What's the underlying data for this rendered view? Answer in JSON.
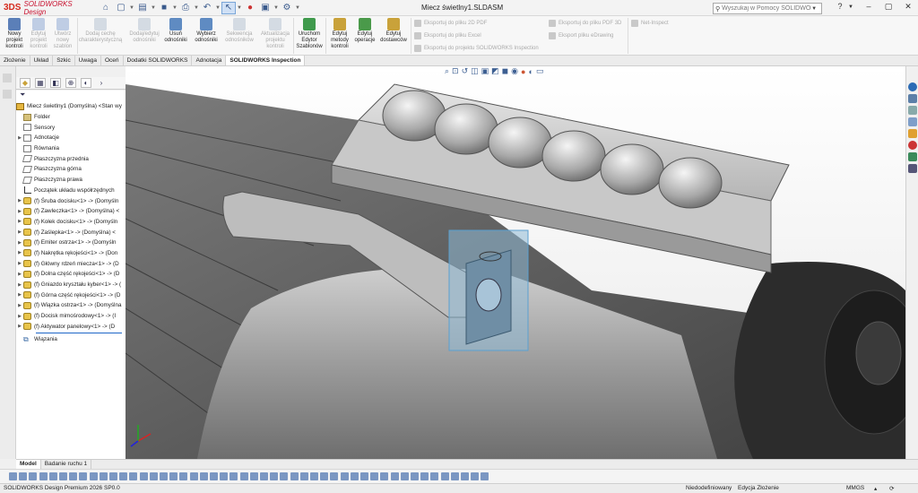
{
  "app": {
    "brand_prefix": "3DS",
    "brand": "SOLIDWORKS Design",
    "document_title": "Miecz świetlny1.SLDASM"
  },
  "search": {
    "placeholder": "Wyszukaj w Pomocy SOLIDWORKS"
  },
  "ribbon": {
    "buttons": [
      {
        "label": "Nowy projekt kontroli",
        "enabled": true
      },
      {
        "label": "Edytuj projekt kontroli",
        "enabled": false
      },
      {
        "label": "Utwórz nowy szablon",
        "enabled": false
      },
      {
        "label": "Dodaj cechę charakterystyczną",
        "enabled": false
      },
      {
        "label": "Dodaj/edytuj odnośniki",
        "enabled": false
      },
      {
        "label": "Usuń odnośniki",
        "enabled": true
      },
      {
        "label": "Wybierz odnośniki",
        "enabled": true
      },
      {
        "label": "Sekwencja odnośników",
        "enabled": false
      },
      {
        "label": "Aktualizacja projektu kontroli",
        "enabled": false
      },
      {
        "label": "Uruchom Edytor Szablonów",
        "enabled": true
      },
      {
        "label": "Edytuj metody kontroli",
        "enabled": true
      },
      {
        "label": "Edytuj operacje",
        "enabled": true
      },
      {
        "label": "Edytuj dostawców",
        "enabled": true
      }
    ],
    "exports": [
      "Eksportuj do pliku 2D PDF",
      "Eksportuj do pliku Excel",
      "Eksportuj do projektu SOLIDWORKS Inspection",
      "Eksportuj do pliku PDF 3D",
      "Eksport pliku eDrawing",
      "Net-Inspect"
    ]
  },
  "tabs": [
    "Złożenie",
    "Układ",
    "Szkic",
    "Uwaga",
    "Oceń",
    "Dodatki SOLIDWORKS",
    "Adnotacja",
    "SOLIDWORKS Inspection"
  ],
  "tree": {
    "root": "Miecz świetlny1 (Domyślna) <Stan wy",
    "items": [
      {
        "label": "Folder",
        "icon": "folder",
        "expand": ""
      },
      {
        "label": "Sensory",
        "icon": "sensor",
        "expand": ""
      },
      {
        "label": "Adnotacje",
        "icon": "annotation",
        "expand": "▶"
      },
      {
        "label": "Równania",
        "icon": "equation",
        "expand": ""
      },
      {
        "label": "Płaszczyzna przednia",
        "icon": "plane",
        "expand": ""
      },
      {
        "label": "Płaszczyzna górna",
        "icon": "plane",
        "expand": ""
      },
      {
        "label": "Płaszczyzna prawa",
        "icon": "plane",
        "expand": ""
      },
      {
        "label": "Początek układu współrzędnych",
        "icon": "origin",
        "expand": ""
      },
      {
        "label": "(f) Śruba docisku<1> -> (Domyśln",
        "icon": "part",
        "expand": "▶"
      },
      {
        "label": "(f) Zawleczka<1> -> (Domyślna) <",
        "icon": "part",
        "expand": "▶"
      },
      {
        "label": "(f) Kołek docisku<1> -> (Domyśln",
        "icon": "part",
        "expand": "▶"
      },
      {
        "label": "(f) Zaślepka<1> -> (Domyślna) <",
        "icon": "part",
        "expand": "▶"
      },
      {
        "label": "(f) Emiter ostrza<1> -> (Domyśln",
        "icon": "part",
        "expand": "▶"
      },
      {
        "label": "(f) Nakrętka rękojeści<1> -> (Don",
        "icon": "part",
        "expand": "▶"
      },
      {
        "label": "(f) Główny rdzeń miecza<1> -> (D",
        "icon": "part",
        "expand": "▶"
      },
      {
        "label": "(f) Dolna część rękojeści<1> -> (D",
        "icon": "part",
        "expand": "▶"
      },
      {
        "label": "(f) Gniazdo kryształu kyber<1> -> (",
        "icon": "part",
        "expand": "▶"
      },
      {
        "label": "(f) Górna część rękojeści<1> -> (D",
        "icon": "part",
        "expand": "▶"
      },
      {
        "label": "(f) Wiązka ostrza<1> -> (Domyślna",
        "icon": "part",
        "expand": "▶"
      },
      {
        "label": "(f) Docisk mimośrodowy<1> -> (I",
        "icon": "part",
        "expand": "▶"
      },
      {
        "label": "(f) Aktywator panelowy<1> -> (D",
        "icon": "part",
        "expand": "▶"
      }
    ],
    "mates": "Wiązania"
  },
  "bottom_tabs": [
    "Model",
    "Badanie ruchu 1"
  ],
  "status": {
    "product": "SOLIDWORKS Design Premium 2026 SP0.0",
    "state": "Niedodefiniowany",
    "mode": "Edycja Złożenie",
    "units": "MMGS"
  }
}
